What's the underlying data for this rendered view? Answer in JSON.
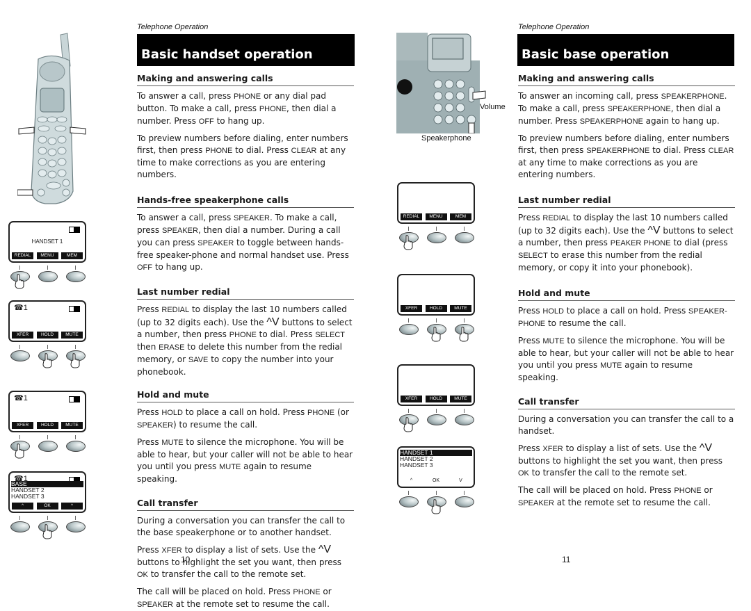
{
  "left_page": {
    "running_head": "Telephone Operation",
    "title": "Basic handset operation",
    "page_number": "10",
    "sections": [
      {
        "heading": "Making and answering calls",
        "paragraphs": [
          [
            {
              "t": "To answer a call, press "
            },
            {
              "k": "PHONE"
            },
            {
              "t": " or any dial pad button. To make a call, press "
            },
            {
              "k": "PHONE"
            },
            {
              "t": ", then dial a number. Press "
            },
            {
              "k": "OFF"
            },
            {
              "t": " to hang up."
            }
          ],
          [
            {
              "t": "To preview numbers before dialing, enter numbers first, then press "
            },
            {
              "k": "PHONE"
            },
            {
              "t": "  to dial. Press "
            },
            {
              "k": "CLEAR"
            },
            {
              "t": " at any time to make corrections as you are entering numbers."
            }
          ]
        ]
      },
      {
        "heading": "Hands-free speakerphone calls",
        "paragraphs": [
          [
            {
              "t": "To answer a call, press "
            },
            {
              "k": "SPEAKER"
            },
            {
              "t": ". To make a call, press "
            },
            {
              "k": "SPEAKER"
            },
            {
              "t": ", then dial a number. During a call you can press "
            },
            {
              "k": "SPEAKER"
            },
            {
              "t": " to toggle between hands-free speaker-phone and normal handset use. Press "
            },
            {
              "k": "OFF"
            },
            {
              "t": " to hang up."
            }
          ]
        ]
      },
      {
        "heading": "Last number redial",
        "paragraphs": [
          [
            {
              "t": "Press "
            },
            {
              "k": "REDIAL"
            },
            {
              "t": "  to display the last 10 numbers called (up to 32 digits each). Use the "
            },
            {
              "a": "^V"
            },
            {
              "t": "     buttons to select a number, then press "
            },
            {
              "k": "PHONE"
            },
            {
              "t": " to dial. Press "
            },
            {
              "k": "SELECT"
            },
            {
              "t": " then "
            },
            {
              "k": "ERASE"
            },
            {
              "t": " to delete this number from the redial memory, or "
            },
            {
              "k": "SAVE"
            },
            {
              "t": " to copy the number into your phonebook."
            }
          ]
        ]
      },
      {
        "heading": "Hold and mute",
        "paragraphs": [
          [
            {
              "t": "Press "
            },
            {
              "k": "HOLD"
            },
            {
              "t": " to place a call on hold. Press "
            },
            {
              "k": "PHONE"
            },
            {
              "t": " (or "
            },
            {
              "k": "SPEAKER"
            },
            {
              "t": ") to resume the call."
            }
          ],
          [
            {
              "t": "Press "
            },
            {
              "k": "MUTE"
            },
            {
              "t": " to silence the microphone. You will be able to hear, but your caller will not be able to hear you until you press "
            },
            {
              "k": "MUTE"
            },
            {
              "t": " again to resume speaking."
            }
          ]
        ]
      },
      {
        "heading": "Call transfer",
        "paragraphs": [
          [
            {
              "t": "During a conversation you can transfer the call to the base speakerphone or to another handset."
            }
          ],
          [
            {
              "t": "Press "
            },
            {
              "k": "XFER"
            },
            {
              "t": " to display a list of sets. Use the "
            },
            {
              "a": "^V"
            },
            {
              "t": " buttons to highlight the set you want, then press "
            },
            {
              "k": "OK"
            },
            {
              "t": " to transfer the call to the remote set."
            }
          ],
          [
            {
              "t": "The call will be placed on hold. Press "
            },
            {
              "k": "PHONE"
            },
            {
              "t": " or "
            },
            {
              "k": "SPEAKER"
            },
            {
              "t": " at the remote set to resume the call."
            }
          ]
        ]
      }
    ],
    "illustrations": {
      "handset_label": "cordless handset with keypad",
      "screens": [
        {
          "icon": "",
          "center": "HANDSET 1",
          "list": [],
          "softkeys": [
            "REDIAL",
            "MENU",
            "MEM"
          ],
          "pressed": [
            0
          ]
        },
        {
          "icon": "☎1",
          "center": "",
          "list": [],
          "softkeys": [
            "XFER",
            "HOLD",
            "MUTE"
          ],
          "pressed": [
            1,
            2
          ]
        },
        {
          "icon": "☎1",
          "center": "",
          "list": [],
          "softkeys": [
            "XFER",
            "HOLD",
            "MUTE"
          ],
          "pressed": [
            0
          ]
        },
        {
          "icon": "☎1",
          "center": "",
          "list": [
            "BASE",
            "HANDSET 2",
            "HANDSET 3"
          ],
          "selected": 0,
          "softkeys": [
            "^",
            "OK",
            "^"
          ],
          "pressed": [
            1
          ]
        }
      ]
    }
  },
  "right_page": {
    "running_head": "Telephone Operation",
    "title": "Basic base operation",
    "page_number": "11",
    "base_captions": {
      "volume": "Volume",
      "speakerphone": "Speakerphone"
    },
    "sections": [
      {
        "heading": "Making and answering calls",
        "paragraphs": [
          [
            {
              "t": "To answer an incoming call, press "
            },
            {
              "k": "SPEAKERPHONE"
            },
            {
              "t": ". To make a call, press "
            },
            {
              "k": "SPEAKERPHONE"
            },
            {
              "t": ", then dial a number. Press "
            },
            {
              "k": "SPEAKERPHONE"
            },
            {
              "t": "  again to hang up."
            }
          ],
          [
            {
              "t": "To preview numbers before dialing, enter numbers first, then press "
            },
            {
              "k": "SPEAKERPHONE"
            },
            {
              "t": "  to dial. Press "
            },
            {
              "k": "CLEAR"
            },
            {
              "t": " at any time to make corrections as you are entering numbers."
            }
          ]
        ]
      },
      {
        "heading": "Last number redial",
        "paragraphs": [
          [
            {
              "t": "Press "
            },
            {
              "k": "REDIAL"
            },
            {
              "t": "  to display the last 10 numbers called (up to 32 digits each).  Use the "
            },
            {
              "a": "^V"
            },
            {
              "t": "     buttons to select a number, then press "
            },
            {
              "k": "PEAKER PHONE"
            },
            {
              "t": " to dial (press "
            },
            {
              "k": "SELECT"
            },
            {
              "t": "  to erase this number from the redial memory, or copy it into your phonebook)."
            }
          ]
        ]
      },
      {
        "heading": "Hold and mute",
        "paragraphs": [
          [
            {
              "t": "Press "
            },
            {
              "k": "HOLD"
            },
            {
              "t": " to place a call on hold. Press "
            },
            {
              "k": "SPEAKER-PHONE"
            },
            {
              "t": " to resume the call."
            }
          ],
          [
            {
              "t": "Press "
            },
            {
              "k": "MUTE"
            },
            {
              "t": "  to silence the microphone. You will be able to hear, but your caller will not be able to hear you until you press "
            },
            {
              "k": "MUTE"
            },
            {
              "t": "  again to resume speaking."
            }
          ]
        ]
      },
      {
        "heading": "Call transfer",
        "paragraphs": [
          [
            {
              "t": "During a conversation you can transfer the call to a handset."
            }
          ],
          [
            {
              "t": "Press "
            },
            {
              "k": "XFER"
            },
            {
              "t": " to display a list of sets. Use the "
            },
            {
              "a": "^V"
            },
            {
              "t": " buttons to highlight the set you want, then press "
            },
            {
              "k": "OK"
            },
            {
              "t": " to transfer the call to the remote set."
            }
          ],
          [
            {
              "t": "The call will be placed on hold. Press "
            },
            {
              "k": "PHONE"
            },
            {
              "t": " or "
            },
            {
              "k": "SPEAKER"
            },
            {
              "t": " at the remote set to resume the call."
            }
          ]
        ]
      }
    ],
    "illustrations": {
      "screens": [
        {
          "icon": "",
          "center": "",
          "list": [],
          "softkeys": [
            "REDIAL",
            "MENU",
            "MEM"
          ],
          "pressed": [
            0
          ]
        },
        {
          "icon": "",
          "center": "",
          "list": [],
          "softkeys": [
            "XFER",
            "HOLD",
            "MUTE"
          ],
          "pressed": [
            1,
            2
          ]
        },
        {
          "icon": "",
          "center": "",
          "list": [],
          "softkeys": [
            "XFER",
            "HOLD",
            "MUTE"
          ],
          "pressed": [
            0
          ]
        },
        {
          "icon": "",
          "center": "",
          "list": [
            "HANDSET 1",
            "HANDSET 2",
            "HANDSET 3"
          ],
          "selected": 0,
          "softkeys": [
            "^",
            "OK",
            "V"
          ],
          "plainkeys": true,
          "pressed": [
            1
          ]
        }
      ]
    }
  }
}
